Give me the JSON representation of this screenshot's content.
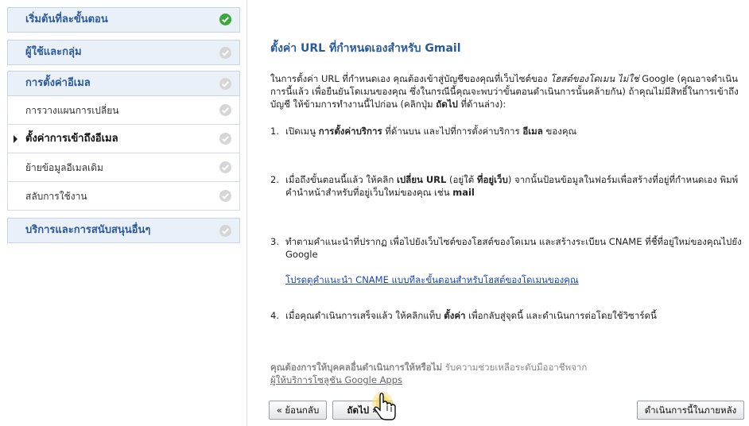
{
  "sidebar": {
    "sections": [
      {
        "label": "เริ่มต้นที่ละขั้นตอน",
        "status": "complete"
      },
      {
        "label": "ผู้ใช้และกลุ่ม",
        "status": "pending"
      },
      {
        "label": "การตั้งค่าอีเมล",
        "status": "pending"
      },
      {
        "label": "บริการและการสนับสนุนอื่นๆ",
        "status": "pending"
      }
    ],
    "email_items": [
      {
        "label": "การวางแผนการเปลี่ยน",
        "active": false
      },
      {
        "label": "ตั้งค่าการเข้าถึงอีเมล",
        "active": true
      },
      {
        "label": "ย้ายข้อมูลอีเมลเดิม",
        "active": false
      },
      {
        "label": "สลับการใช้งาน",
        "active": false
      }
    ]
  },
  "main": {
    "title": "ตั้งค่า URL ที่กำหนดเองสำหรับ Gmail",
    "intro": {
      "p1": "ในการตั้งค่า URL ที่กำหนดเอง คุณต้องเข้าสู่บัญชีของคุณที่เว็บไซต์ของ ",
      "host_italic": "โฮสต์ของโดเมน ไม่ใช่",
      "p2": " Google (คุณอาจดำเนินการนี้แล้ว เพื่อยืนยันโดเมนของคุณ ซึ่งในกรณีนี้คุณจะพบว่าขั้นตอนดำเนินการนั้นคล้ายกัน) ถ้าคุณไม่มีสิทธิ์ในการเข้าถึงบัญชี ให้ข้ามการทำงานนี้ไปก่อน (คลิกปุ่ม ",
      "next_bold": "ถัดไป",
      "p3": " ที่ด้านล่าง):"
    },
    "steps": [
      {
        "num": "1.",
        "a": "เปิดเมนู ",
        "a_bold": "การตั้งค่าบริการ",
        "b": " ที่ด้านบน และไปที่การตั้งค่าบริการ ",
        "b_bold": "อีเมล",
        "c": " ของคุณ"
      },
      {
        "num": "2.",
        "a": "เมื่อถึงขั้นตอนนี้แล้ว ให้คลิก ",
        "a_bold": "เปลี่ยน URL",
        "b": " (อยู่ใต้ ",
        "b_bold": "ที่อยู่เว็บ",
        "c": ") จากนั้นป้อนข้อมูลในฟอร์มเพื่อสร้างที่อยู่ที่กำหนดเอง พิมพ์คำนำหน้าสำหรับที่อยู่เว็บใหม่ของคุณ เช่น ",
        "c_bold": "mail"
      },
      {
        "num": "3.",
        "text": "ทำตามคำแนะนำที่ปรากฏ เพื่อไปยังเว็บไซต์ของโฮสต์ของโดเมน และสร้างระเบียน CNAME ที่ชี้ที่อยู่ใหม่ของคุณไปยัง Google"
      },
      {
        "num": "4.",
        "a": "เมื่อคุณดำเนินการเสร็จแล้ว ให้คลิกแท็บ ",
        "a_bold": "ตั้งค่า",
        "b": " เพื่อกลับสู่จุดนี้ และดำเนินการต่อโดยใช้วิซาร์ดนี้"
      }
    ],
    "cname_link": "โปรดดูคำแนะนำ CNAME แบบทีละขั้นตอนสำหรับโฮสต์ของโดเมนของคุณ",
    "help_question": "คุณต้องการให้บุคคลอื่นดำเนินการให้หรือไม่",
    "help_text": " รับความช่วยเหลือระดับมืออาชีพจาก",
    "help_link": "ผู้ให้บริการโซลูชัน Google Apps",
    "buttons": {
      "back": "« ย้อนกลับ",
      "next": "ถัดไป »",
      "later": "ดำเนินการนี้ในภายหลัง"
    }
  },
  "colors": {
    "link": "#1a44b0",
    "heading": "#2a5a9c",
    "complete": "#3aa83a",
    "pending": "#d6d6d6"
  }
}
